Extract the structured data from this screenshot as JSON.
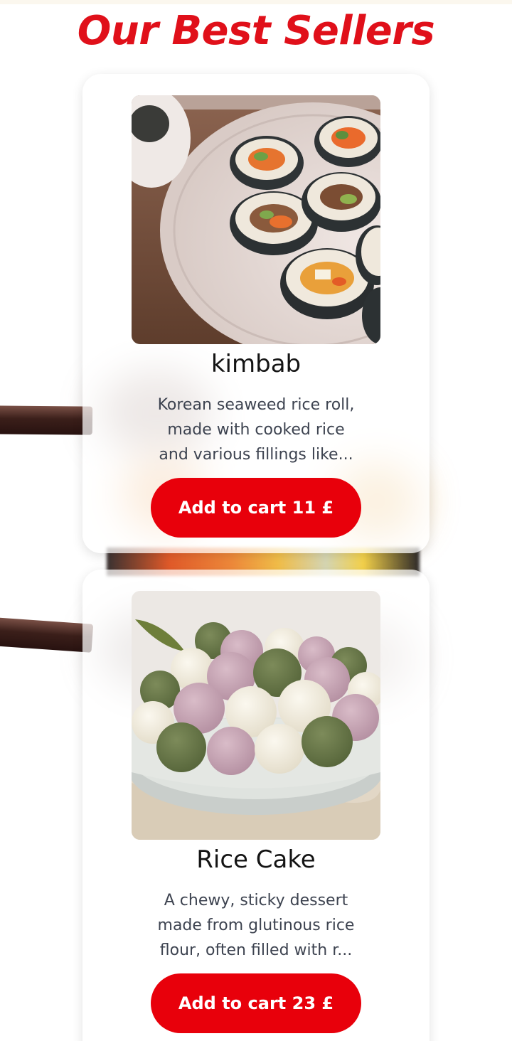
{
  "section": {
    "title": "Our Best Sellers"
  },
  "products": [
    {
      "name": "kimbab",
      "description_lines": [
        "Korean seaweed rice roll,",
        "made with cooked rice",
        "and various fillings like..."
      ],
      "cart_button_label": "Add to cart 11 £",
      "image_icon": "kimbap-photo"
    },
    {
      "name": "Rice Cake",
      "description_lines": [
        "A chewy, sticky dessert",
        "made from glutinous rice",
        "flour, often filled with r..."
      ],
      "cart_button_label": "Add to cart 23 £",
      "image_icon": "rice-cake-photo"
    }
  ],
  "colors": {
    "accent": "#e8000b",
    "title": "#e0101a",
    "text_muted": "#3d4350"
  }
}
